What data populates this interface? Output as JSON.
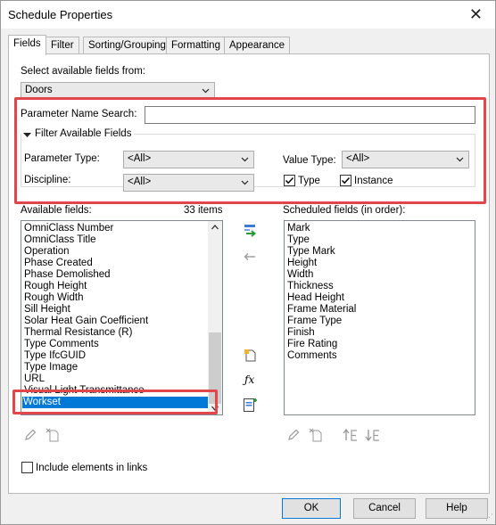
{
  "window": {
    "title": "Schedule Properties",
    "close_glyph": "✕"
  },
  "tabs": [
    {
      "label": "Fields",
      "active": true
    },
    {
      "label": "Filter"
    },
    {
      "label": "Sorting/Grouping"
    },
    {
      "label": "Formatting"
    },
    {
      "label": "Appearance"
    }
  ],
  "select_from": {
    "label": "Select available fields from:",
    "value": "Doors"
  },
  "search": {
    "label": "Parameter Name Search:",
    "value": ""
  },
  "filter_group": {
    "title": "Filter Available Fields",
    "parameter_type": {
      "label": "Parameter Type:",
      "value": "<All>"
    },
    "discipline": {
      "label": "Discipline:",
      "value": "<All>"
    },
    "value_type": {
      "label": "Value Type:",
      "value": "<All>"
    },
    "type_check": {
      "label": "Type",
      "checked": true
    },
    "instance_check": {
      "label": "Instance",
      "checked": true
    }
  },
  "available": {
    "label": "Available fields:",
    "count": "33 items",
    "items": [
      "OmniClass Number",
      "OmniClass Title",
      "Operation",
      "Phase Created",
      "Phase Demolished",
      "Rough Height",
      "Rough Width",
      "Sill Height",
      "Solar Heat Gain Coefficient",
      "Thermal Resistance (R)",
      "Type Comments",
      "Type IfcGUID",
      "Type Image",
      "URL",
      "Visual Light Transmittance",
      "Workset"
    ],
    "selected": "Workset"
  },
  "scheduled": {
    "label": "Scheduled fields (in order):",
    "items": [
      "Mark",
      "Type",
      "Type Mark",
      "Height",
      "Width",
      "Thickness",
      "Head Height",
      "Frame Material",
      "Frame Type",
      "Finish",
      "Fire Rating",
      "Comments"
    ]
  },
  "include_links": {
    "label": "Include elements in links",
    "checked": false
  },
  "buttons": {
    "ok": "OK",
    "cancel": "Cancel",
    "help": "Help"
  },
  "colors": {
    "highlight_border": "#e0464b",
    "selection": "#0078d7"
  },
  "icons": [
    "add-parameter-icon",
    "remove-parameter-icon",
    "new-parameter-icon",
    "calculated-value-icon",
    "combine-parameters-icon",
    "edit-icon",
    "delete-icon",
    "move-up-icon",
    "move-down-icon"
  ]
}
